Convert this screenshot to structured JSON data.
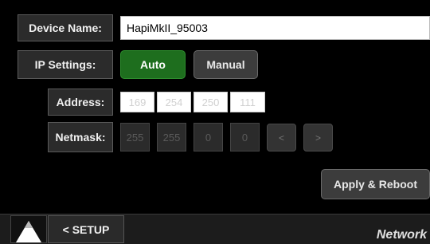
{
  "device_name": {
    "label": "Device Name:",
    "value": "HapiMkII_95003"
  },
  "ip_settings": {
    "label": "IP Settings:",
    "auto_label": "Auto",
    "manual_label": "Manual",
    "mode": "Auto"
  },
  "address": {
    "label": "Address:",
    "octets": [
      "169",
      "254",
      "250",
      "111"
    ]
  },
  "netmask": {
    "label": "Netmask:",
    "octets": [
      "255",
      "255",
      "0",
      "0"
    ],
    "prev_label": "<",
    "next_label": ">"
  },
  "apply_label": "Apply & Reboot",
  "footer": {
    "setup_label": "< SETUP",
    "title": "Network"
  },
  "colors": {
    "active_green": "#1e6e1e",
    "panel_gray": "#2b2b2b",
    "background": "#000000"
  }
}
